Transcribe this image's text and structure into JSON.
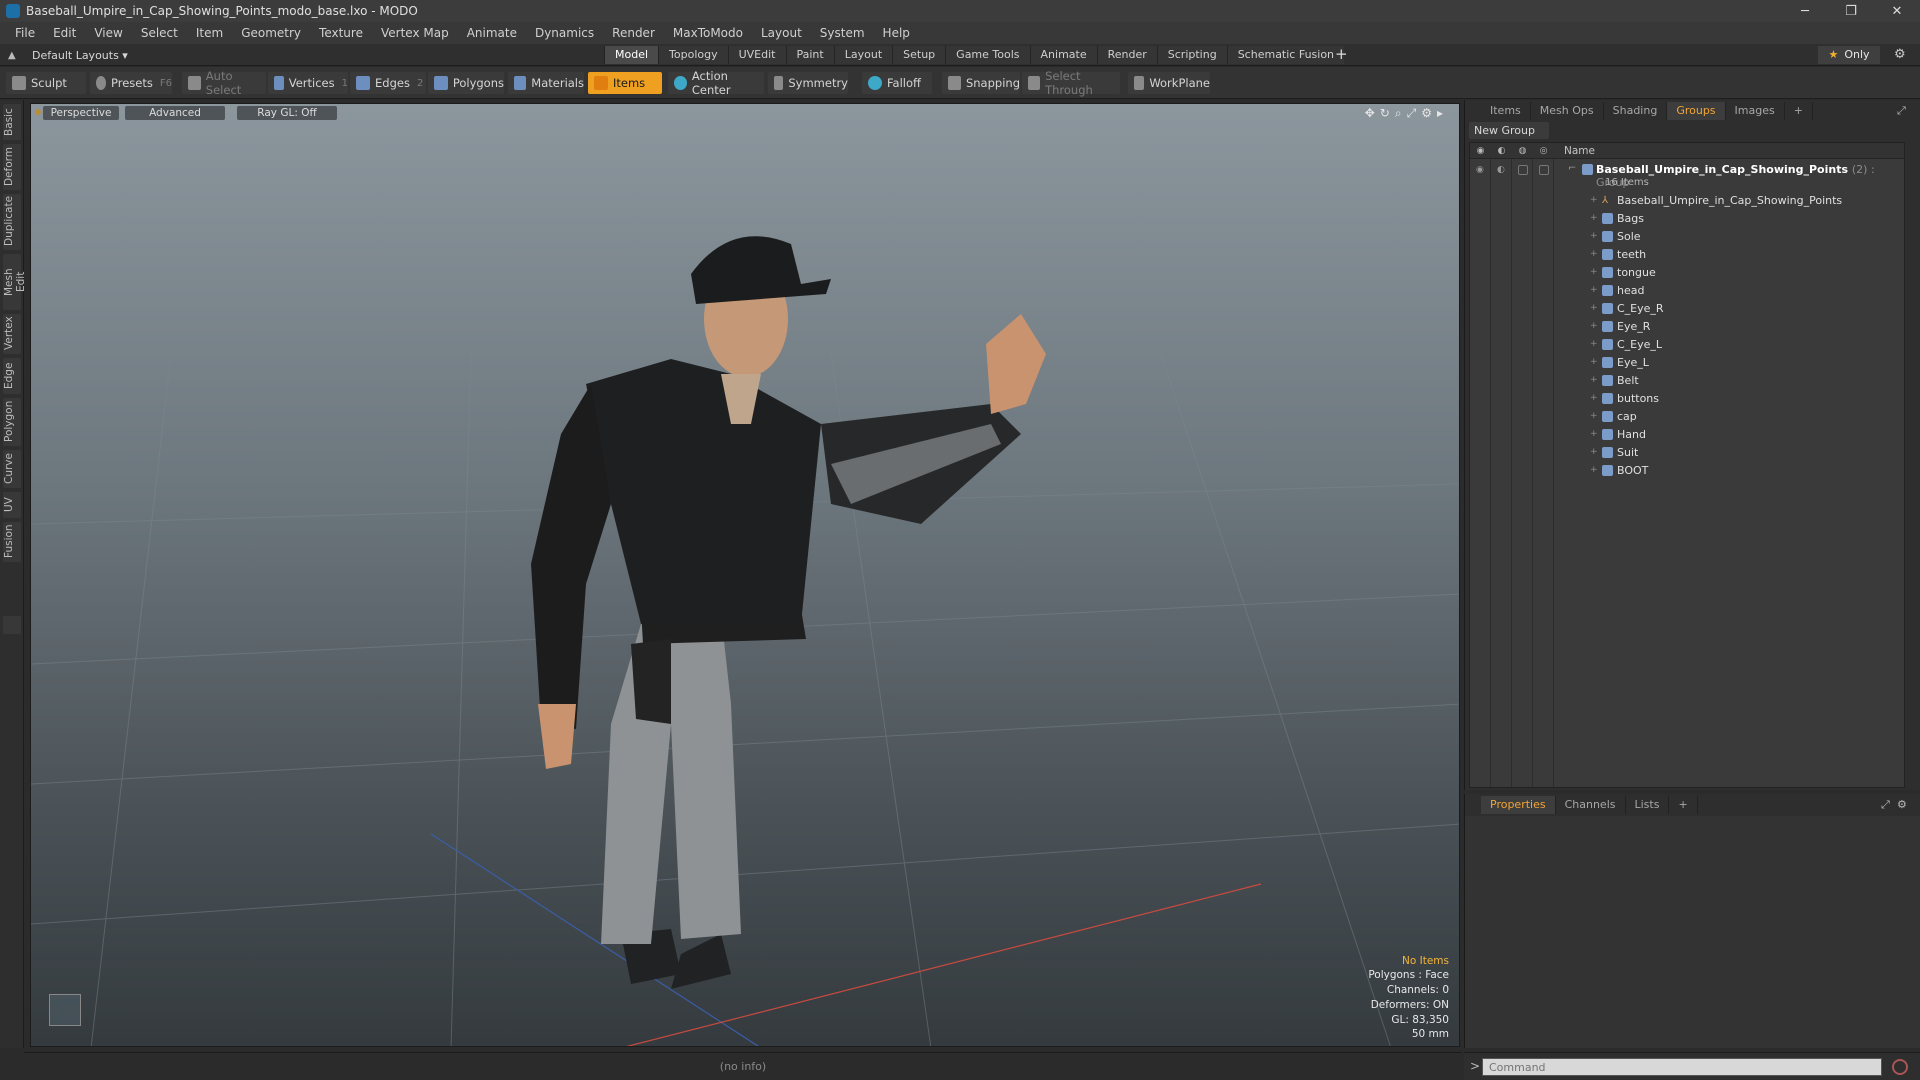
{
  "window": {
    "title": "Baseball_Umpire_in_Cap_Showing_Points_modo_base.lxo - MODO",
    "minimize": "─",
    "restore": "❐",
    "close": "✕"
  },
  "menu": [
    "File",
    "Edit",
    "View",
    "Select",
    "Item",
    "Geometry",
    "Texture",
    "Vertex Map",
    "Animate",
    "Dynamics",
    "Render",
    "MaxToModo",
    "Layout",
    "System",
    "Help"
  ],
  "layoutbar": {
    "selector": "Default Layouts ▾",
    "tabs": [
      "Model",
      "Topology",
      "UVEdit",
      "Paint",
      "Layout",
      "Setup",
      "Game Tools",
      "Animate",
      "Render",
      "Scripting",
      "Schematic Fusion"
    ],
    "active_tab": "Model",
    "plus": "+",
    "only": "Only",
    "star": "★"
  },
  "toolbar": {
    "sculpt": "Sculpt",
    "presets": "Presets",
    "presets_key": "F6",
    "auto_select": "Auto Select",
    "vertices": "Vertices",
    "vertices_key": "1",
    "edges": "Edges",
    "edges_key": "2",
    "polygons": "Polygons",
    "materials": "Materials",
    "items": "Items",
    "action_center": "Action Center",
    "symmetry": "Symmetry",
    "falloff": "Falloff",
    "snapping": "Snapping",
    "select_through": "Select Through",
    "workplane": "WorkPlane"
  },
  "left_tabs": [
    "Basic",
    "Deform",
    "Duplicate",
    "Mesh Edit",
    "Vertex",
    "Edge",
    "Polygon",
    "Curve",
    "UV",
    "Fusion"
  ],
  "viewport": {
    "view": "Perspective",
    "shading": "Advanced",
    "raygl": "Ray GL: Off",
    "info": {
      "selection": "No Items",
      "polygons": "Polygons : Face",
      "channels": "Channels: 0",
      "deformers": "Deformers: ON",
      "gl": "GL: 83,350",
      "lens": "50 mm"
    }
  },
  "status": "(no info)",
  "groups_panel": {
    "tabs": [
      "Items",
      "Mesh Ops",
      "Shading",
      "Groups",
      "Images"
    ],
    "active_tab": "Groups",
    "new_group": "New Group",
    "column_name": "Name",
    "group_name": "Baseball_Umpire_in_Cap_Showing_Points",
    "group_meta": "(2) : Group",
    "group_count": "16 Items",
    "items": [
      {
        "name": "Baseball_Umpire_in_Cap_Showing_Points",
        "type": "locator"
      },
      {
        "name": "Bags",
        "type": "mesh"
      },
      {
        "name": "Sole",
        "type": "mesh"
      },
      {
        "name": "teeth",
        "type": "mesh"
      },
      {
        "name": "tongue",
        "type": "mesh"
      },
      {
        "name": "head",
        "type": "mesh"
      },
      {
        "name": "C_Eye_R",
        "type": "mesh"
      },
      {
        "name": "Eye_R",
        "type": "mesh"
      },
      {
        "name": "C_Eye_L",
        "type": "mesh"
      },
      {
        "name": "Eye_L",
        "type": "mesh"
      },
      {
        "name": "Belt",
        "type": "mesh"
      },
      {
        "name": "buttons",
        "type": "mesh"
      },
      {
        "name": "cap",
        "type": "mesh"
      },
      {
        "name": "Hand",
        "type": "mesh"
      },
      {
        "name": "Suit",
        "type": "mesh"
      },
      {
        "name": "BOOT",
        "type": "mesh"
      }
    ]
  },
  "props_panel": {
    "tabs": [
      "Properties",
      "Channels",
      "Lists"
    ],
    "active_tab": "Properties"
  },
  "command": {
    "placeholder": "Command",
    "prompt": ">"
  },
  "colors": {
    "accent": "#f0a020",
    "active_tab_text": "#f2a535",
    "warning_text": "#f3b53a"
  }
}
